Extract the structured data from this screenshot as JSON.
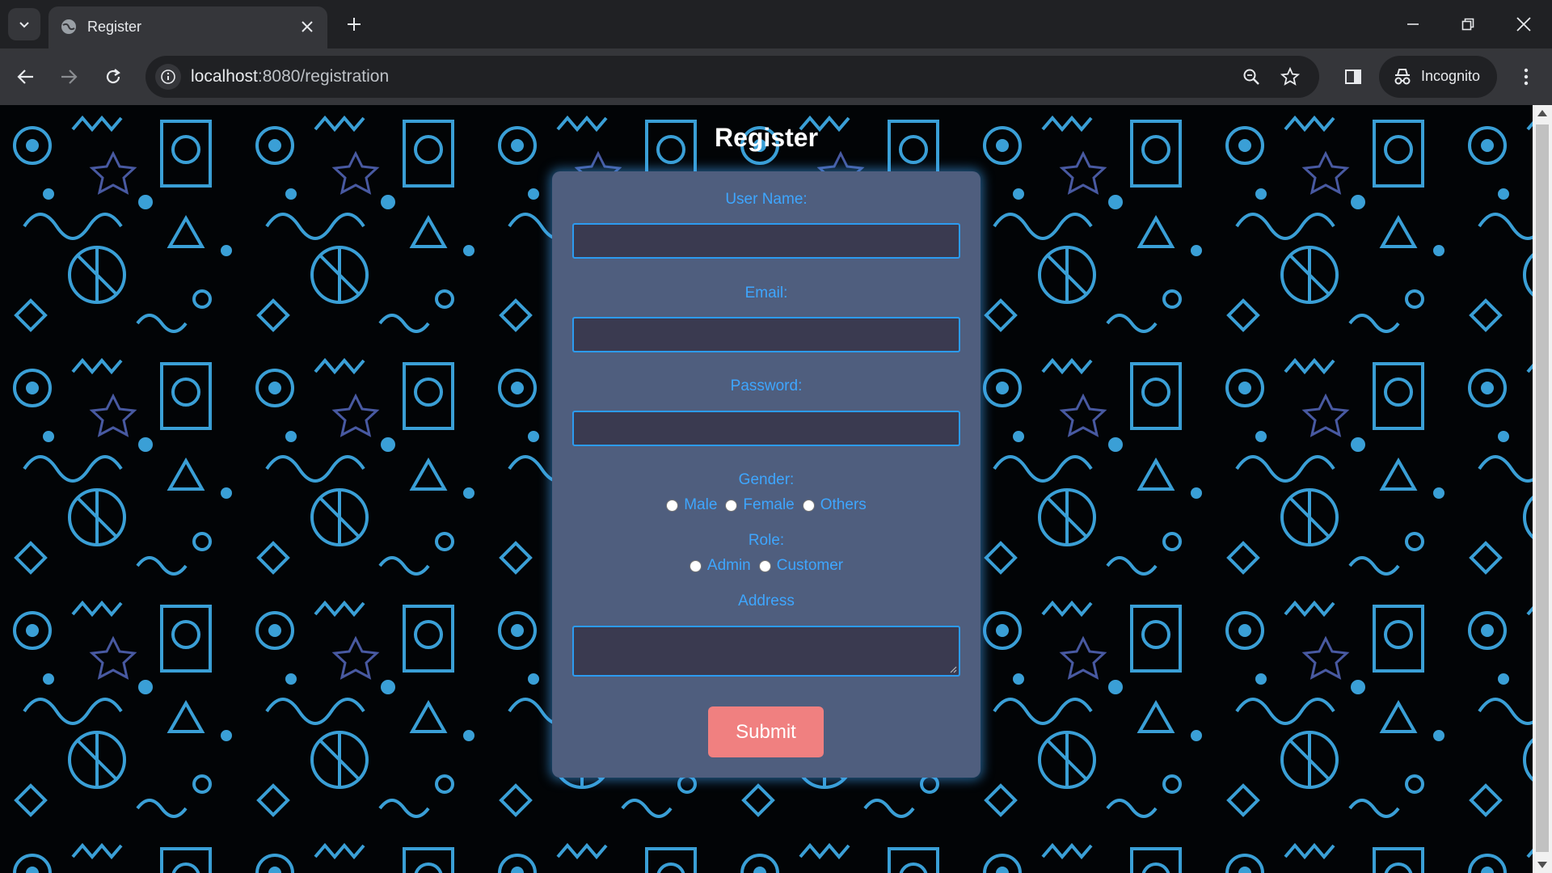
{
  "browser": {
    "tab_title": "Register",
    "url_host": "localhost",
    "url_path": ":8080/registration",
    "incognito_label": "Incognito",
    "icons": [
      "tab-search-icon",
      "globe-icon",
      "close-icon",
      "plus-icon",
      "minimize-icon",
      "restore-icon",
      "close-window-icon",
      "back-arrow-icon",
      "forward-arrow-icon",
      "reload-icon",
      "site-info-icon",
      "zoom-icon",
      "star-icon",
      "side-panel-icon",
      "incognito-icon",
      "kebab-menu-icon"
    ]
  },
  "page": {
    "title": "Register",
    "colors": {
      "card": "#4f5e7e",
      "label": "#3ea6ff",
      "input_bg": "#3a3a50",
      "input_border": "#2c9bf0",
      "submit_bg": "#f08080",
      "doodle": "#3a9fd6"
    }
  },
  "form": {
    "username_label": "User Name:",
    "username_value": "",
    "email_label": "Email:",
    "email_value": "",
    "password_label": "Password:",
    "password_value": "",
    "gender_label": "Gender:",
    "gender_options": [
      "Male",
      "Female",
      "Others"
    ],
    "role_label": "Role:",
    "role_options": [
      "Admin",
      "Customer"
    ],
    "address_label": "Address",
    "address_value": "",
    "submit_label": "Submit"
  }
}
